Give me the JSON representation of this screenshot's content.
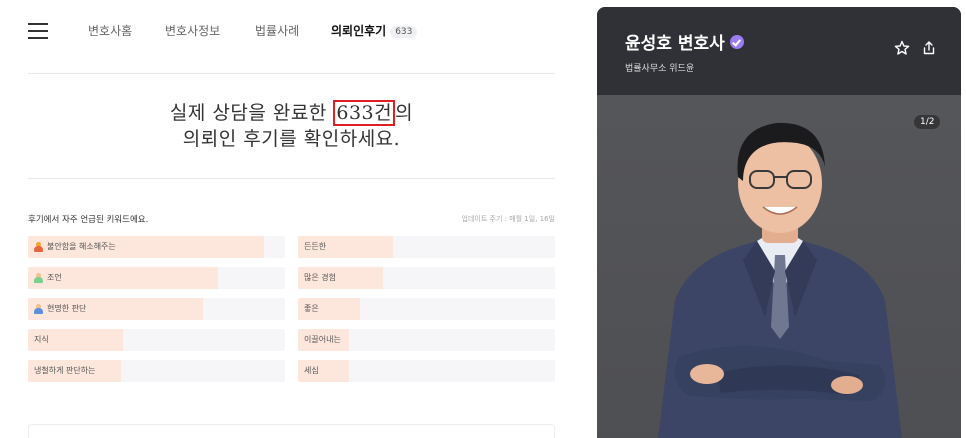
{
  "nav": {
    "tabs": [
      {
        "label": "변호사홈"
      },
      {
        "label": "변호사정보"
      },
      {
        "label": "법률사례"
      },
      {
        "label": "의뢰인후기",
        "badge": "633"
      }
    ]
  },
  "hero": {
    "line1_pre": "실제 상담을 완료한 ",
    "count": "633건",
    "line1_post": "의",
    "line2": "의뢰인 후기를 확인하세요."
  },
  "keywords": {
    "title": "후기에서 자주 언급된 키워드에요.",
    "update_note": "업데이트 주기 : 매월 1일, 16일",
    "items": [
      {
        "label": "불안함을 해소해주는",
        "icon": "person-orange-icon",
        "fill": 0.92
      },
      {
        "label": "든든한",
        "fill": 0.37
      },
      {
        "label": "조언",
        "icon": "person-green-icon",
        "fill": 0.74
      },
      {
        "label": "많은 경험",
        "fill": 0.33
      },
      {
        "label": "현명한 판단",
        "icon": "person-blue-icon",
        "fill": 0.68
      },
      {
        "label": "좋은",
        "fill": 0.24
      },
      {
        "label": "지식",
        "fill": 0.37
      },
      {
        "label": "이끌어내는",
        "fill": 0.2
      },
      {
        "label": "냉철하게 판단하는",
        "fill": 0.36
      },
      {
        "label": "세심",
        "fill": 0.2
      }
    ]
  },
  "profile": {
    "name": "윤성호 변호사",
    "firm": "법률사무소 위드윤",
    "photo_counter": "1/2"
  },
  "colors": {
    "keyword_fill": "#fde6dc",
    "keyword_track": "#f6f6f8",
    "verified": "#9b7cf2",
    "highlight_box": "#e02020",
    "profile_header": "#2f3136"
  }
}
